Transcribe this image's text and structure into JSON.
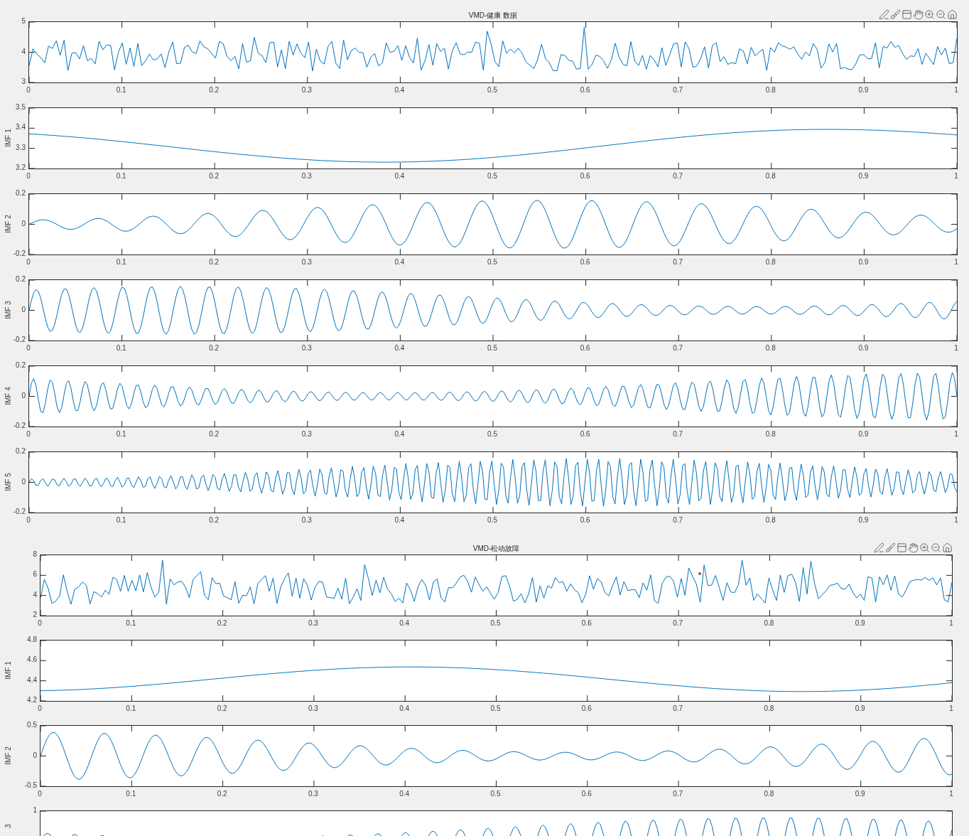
{
  "figures": [
    {
      "title": "VMD-健康 数据",
      "axes": [
        {
          "yticks": [
            "5",
            "4",
            "3"
          ],
          "xticks": [
            "0",
            "0.1",
            "0.2",
            "0.3",
            "0.4",
            "0.5",
            "0.6",
            "0.7",
            "0.8",
            "0.9",
            "1"
          ]
        },
        {
          "ylabel": "IMF 1",
          "yticks": [
            "3.5",
            "3.4",
            "3.3",
            "3.2"
          ],
          "xticks": [
            "0",
            "0.1",
            "0.2",
            "0.3",
            "0.4",
            "0.5",
            "0.6",
            "0.7",
            "0.8",
            "0.9",
            "1"
          ]
        },
        {
          "ylabel": "IMF 2",
          "yticks": [
            "0.2",
            "0",
            "-0.2"
          ],
          "xticks": [
            "0",
            "0.1",
            "0.2",
            "0.3",
            "0.4",
            "0.5",
            "0.6",
            "0.7",
            "0.8",
            "0.9",
            "1"
          ]
        },
        {
          "ylabel": "IMF 3",
          "yticks": [
            "0.2",
            "0",
            "-0.2"
          ],
          "xticks": [
            "0",
            "0.1",
            "0.2",
            "0.3",
            "0.4",
            "0.5",
            "0.6",
            "0.7",
            "0.8",
            "0.9",
            "1"
          ]
        },
        {
          "ylabel": "IMF 4",
          "yticks": [
            "0.2",
            "0",
            "-0.2"
          ],
          "xticks": [
            "0",
            "0.1",
            "0.2",
            "0.3",
            "0.4",
            "0.5",
            "0.6",
            "0.7",
            "0.8",
            "0.9",
            "1"
          ]
        },
        {
          "ylabel": "IMF 5",
          "yticks": [
            "0.2",
            "0",
            "-0.2"
          ],
          "xticks": [
            "0",
            "0.1",
            "0.2",
            "0.3",
            "0.4",
            "0.5",
            "0.6",
            "0.7",
            "0.8",
            "0.9",
            "1"
          ]
        }
      ]
    },
    {
      "title": "VMD-松动故障",
      "axes": [
        {
          "yticks": [
            "8",
            "6",
            "4",
            "2"
          ],
          "xticks": [
            "0",
            "0.1",
            "0.2",
            "0.3",
            "0.4",
            "0.5",
            "0.6",
            "0.7",
            "0.8",
            "0.9",
            "1"
          ]
        },
        {
          "ylabel": "IMF 1",
          "yticks": [
            "4.8",
            "4.6",
            "4.4",
            "4.2"
          ],
          "xticks": [
            "0",
            "0.1",
            "0.2",
            "0.3",
            "0.4",
            "0.5",
            "0.6",
            "0.7",
            "0.8",
            "0.9",
            "1"
          ]
        },
        {
          "ylabel": "IMF 2",
          "yticks": [
            "0.5",
            "0",
            "-0.5"
          ],
          "xticks": [
            "0",
            "0.1",
            "0.2",
            "0.3",
            "0.4",
            "0.5",
            "0.6",
            "0.7",
            "0.8",
            "0.9",
            "1"
          ]
        },
        {
          "ylabel": "3",
          "yticks": [
            "1"
          ]
        }
      ]
    }
  ]
}
